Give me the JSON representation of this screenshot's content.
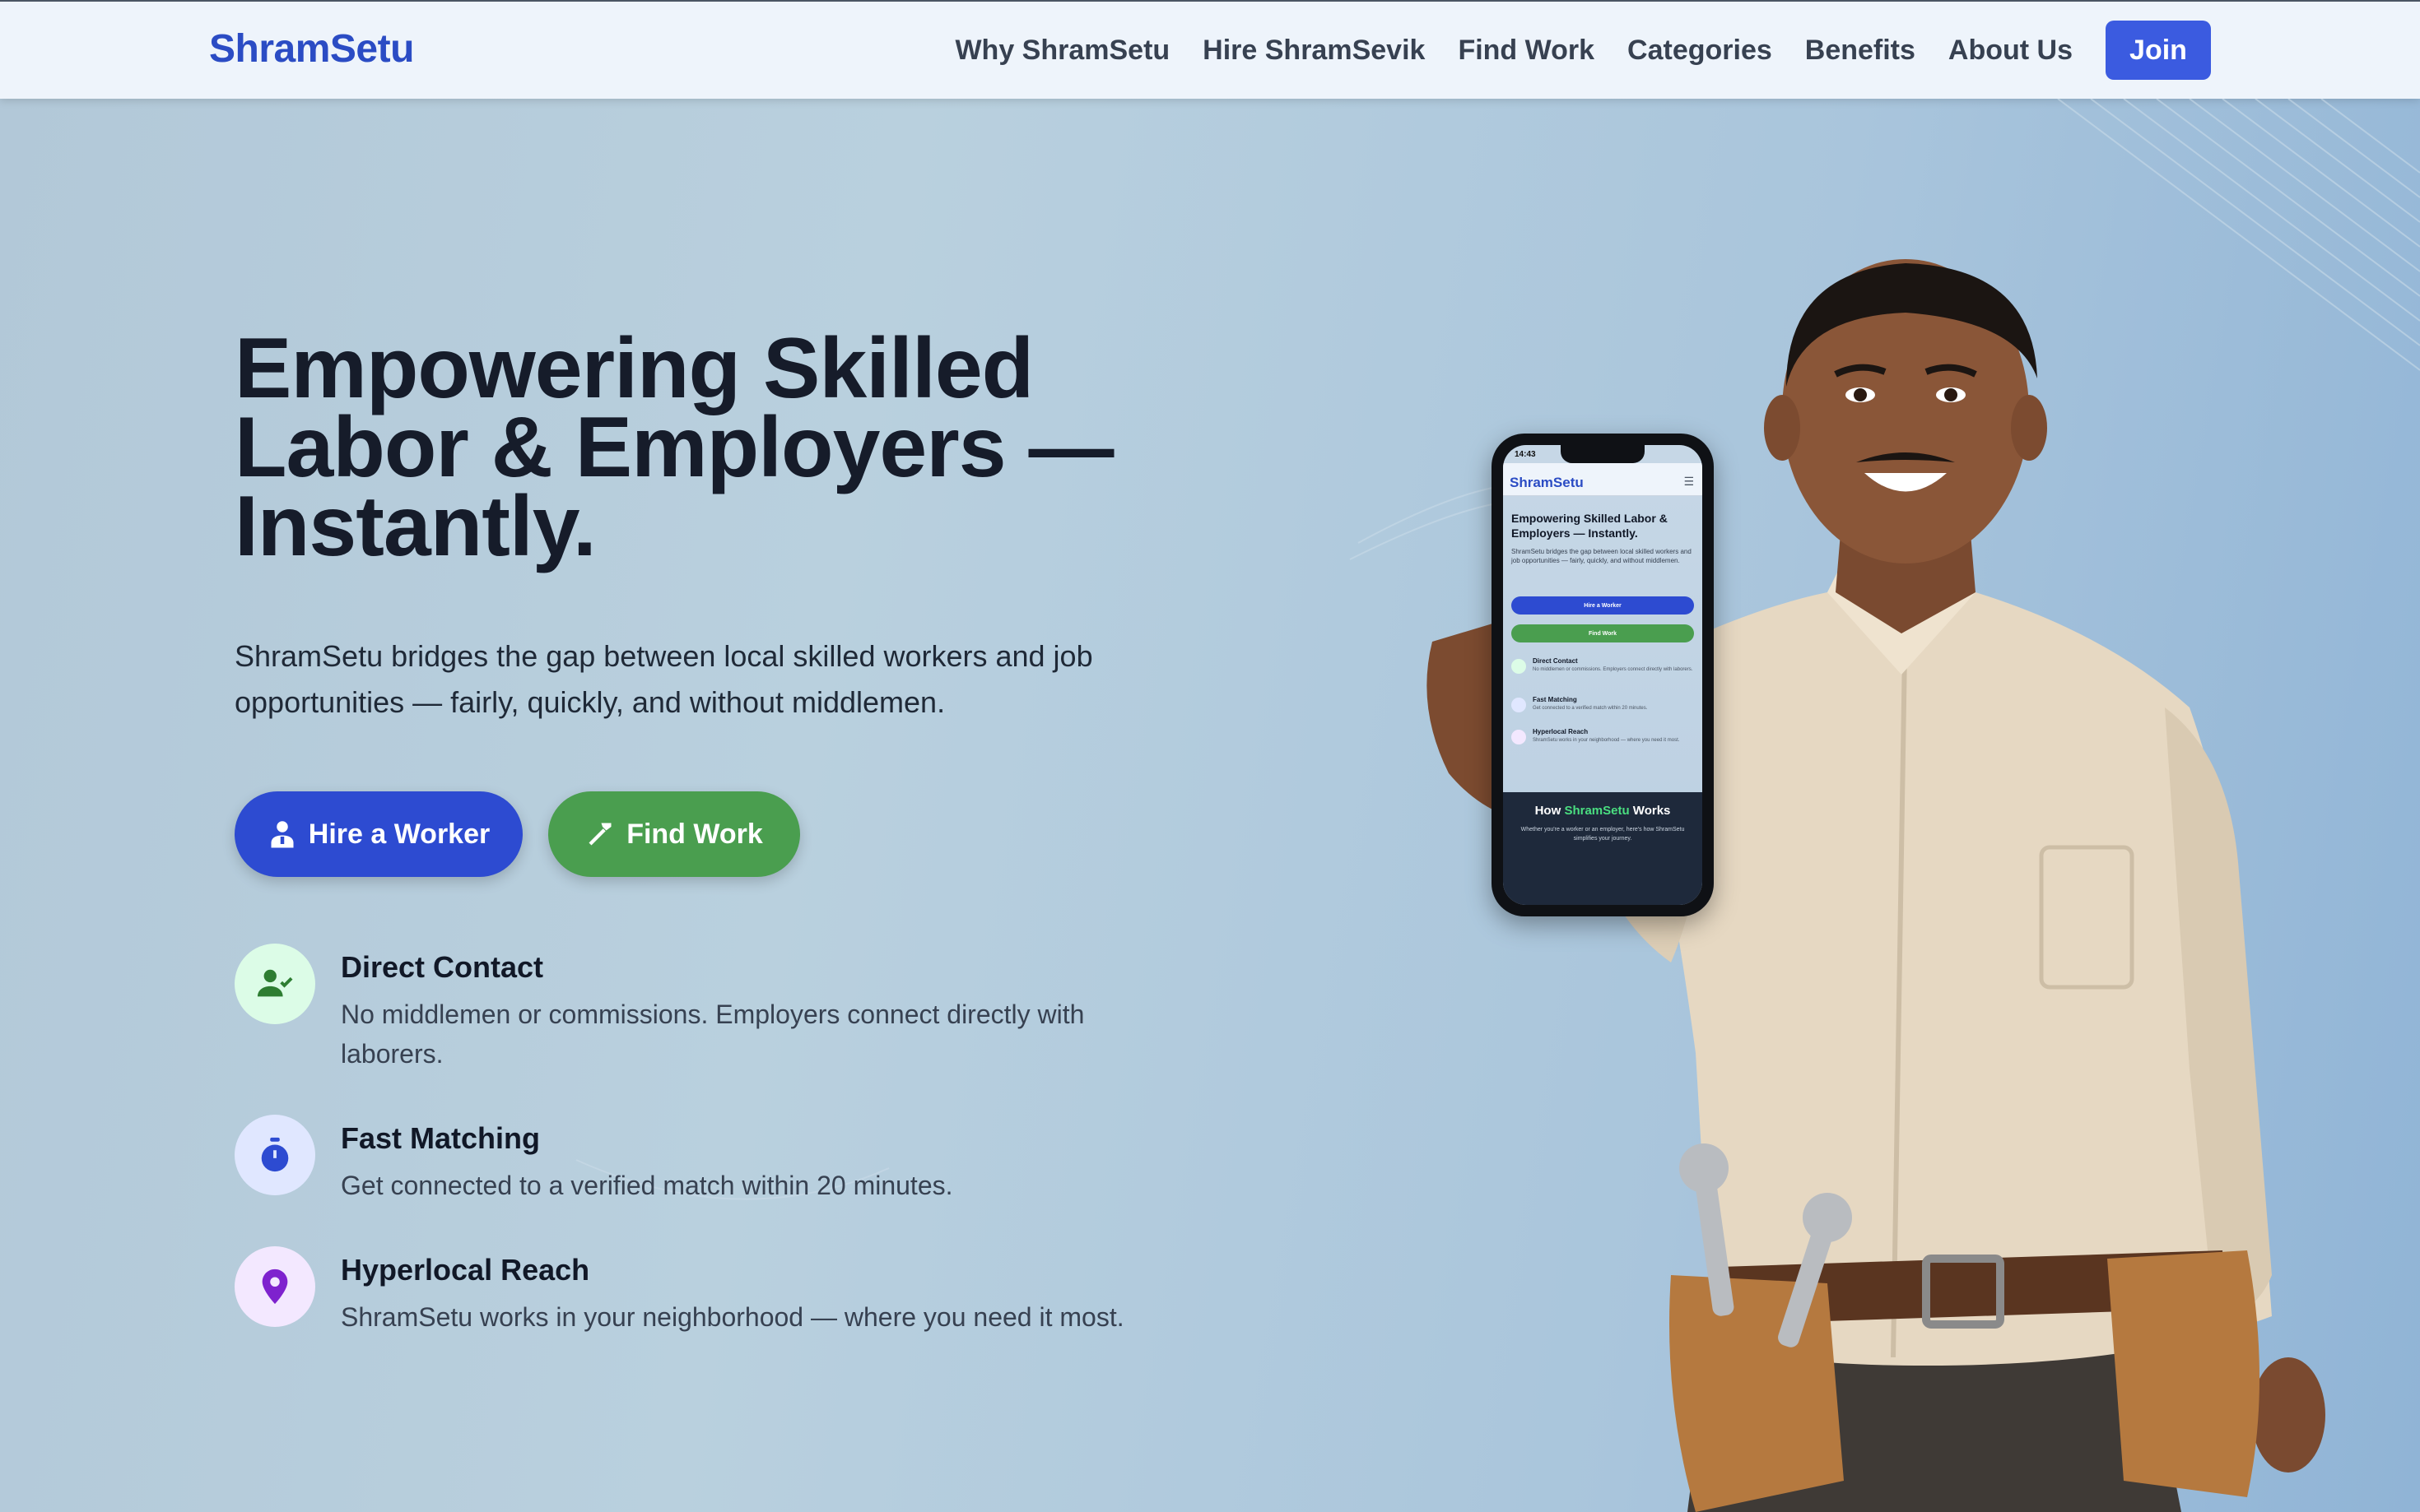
{
  "brand": "ShramSetu",
  "nav": {
    "links": [
      "Why ShramSetu",
      "Hire ShramSevik",
      "Find Work",
      "Categories",
      "Benefits",
      "About Us"
    ],
    "join_label": "Join"
  },
  "hero": {
    "title_line1": "Empowering Skilled",
    "title_line2": "Labor & Employers —",
    "title_line3": "Instantly.",
    "subtitle": "ShramSetu bridges the gap between local skilled workers and job opportunities — fairly, quickly, and without middlemen.",
    "hire_label": "Hire a Worker",
    "find_label": "Find Work"
  },
  "features": [
    {
      "title": "Direct Contact",
      "desc": "No middlemen or commissions. Employers connect directly with laborers.",
      "icon": "user-check-icon",
      "icon_bg": "#dcfce7",
      "icon_color": "#2e7d32"
    },
    {
      "title": "Fast Matching",
      "desc": "Get connected to a verified match within 20 minutes.",
      "icon": "stopwatch-icon",
      "icon_bg": "#e0e7ff",
      "icon_color": "#2d4bd1"
    },
    {
      "title": "Hyperlocal Reach",
      "desc": "ShramSetu works in your neighborhood — where you need it most.",
      "icon": "map-pin-icon",
      "icon_bg": "#f3e8ff",
      "icon_color": "#7e22ce"
    }
  ],
  "phone": {
    "time": "14:43",
    "brand": "ShramSetu",
    "menu_icon": "hamburger-icon",
    "title": "Empowering Skilled Labor & Employers — Instantly.",
    "subtitle": "ShramSetu bridges the gap between local skilled workers and job opportunities — fairly, quickly, and without middlemen.",
    "hire_label": "Hire a Worker",
    "find_label": "Find Work",
    "features": [
      {
        "title": "Direct Contact",
        "desc": "No middlemen or commissions. Employers connect directly with laborers."
      },
      {
        "title": "Fast Matching",
        "desc": "Get connected to a verified match within 20 minutes."
      },
      {
        "title": "Hyperlocal Reach",
        "desc": "ShramSetu works in your neighborhood — where you need it most."
      }
    ],
    "how_prefix": "How ",
    "how_accent": "ShramSetu",
    "how_suffix": " Works",
    "how_sub": "Whether you're a worker or an employer, here's how ShramSetu simplifies your journey."
  },
  "colors": {
    "brand_blue": "#2b4cc4",
    "primary_button": "#2d4bd1",
    "success_button": "#4a9e4f"
  }
}
